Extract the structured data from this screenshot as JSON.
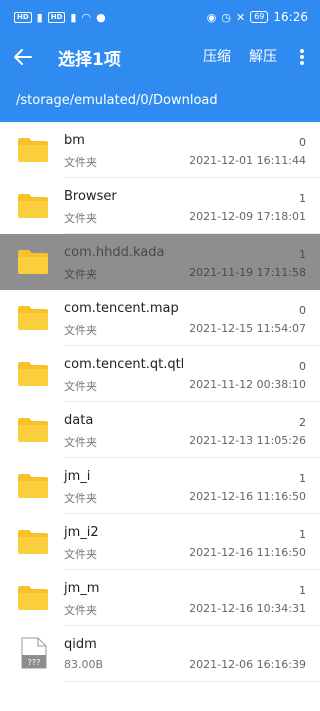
{
  "status_bar": {
    "chips": [
      "HD",
      "HD"
    ],
    "time": "16:26",
    "battery": "69"
  },
  "app_bar": {
    "title": "选择1项",
    "compress_label": "压缩",
    "extract_label": "解压"
  },
  "path": "/storage/emulated/0/Download",
  "files": [
    {
      "name": "bm",
      "type": "文件夹",
      "count": "0",
      "date": "2021-12-01 16:11:44",
      "selected": false,
      "icon": "folder-icon"
    },
    {
      "name": "Browser",
      "type": "文件夹",
      "count": "1",
      "date": "2021-12-09 17:18:01",
      "selected": false,
      "icon": "folder-icon"
    },
    {
      "name": "com.hhdd.kada",
      "type": "文件夹",
      "count": "1",
      "date": "2021-11-19 17:11:58",
      "selected": true,
      "icon": "folder-icon"
    },
    {
      "name": "com.tencent.map",
      "type": "文件夹",
      "count": "0",
      "date": "2021-12-15 11:54:07",
      "selected": false,
      "icon": "folder-icon"
    },
    {
      "name": "com.tencent.qt.qtl",
      "type": "文件夹",
      "count": "0",
      "date": "2021-11-12 00:38:10",
      "selected": false,
      "icon": "folder-icon"
    },
    {
      "name": "data",
      "type": "文件夹",
      "count": "2",
      "date": "2021-12-13 11:05:26",
      "selected": false,
      "icon": "folder-icon"
    },
    {
      "name": "jm_i",
      "type": "文件夹",
      "count": "1",
      "date": "2021-12-16 11:16:50",
      "selected": false,
      "icon": "folder-icon"
    },
    {
      "name": "jm_i2",
      "type": "文件夹",
      "count": "1",
      "date": "2021-12-16 11:16:50",
      "selected": false,
      "icon": "folder-icon"
    },
    {
      "name": "jm_m",
      "type": "文件夹",
      "count": "1",
      "date": "2021-12-16 10:34:31",
      "selected": false,
      "icon": "folder-icon"
    },
    {
      "name": "qidm",
      "type": "83.00B",
      "count": "",
      "date": "2021-12-06 16:16:39",
      "selected": false,
      "icon": "unknown-file-icon",
      "file_icon_text": "???"
    }
  ],
  "colors": {
    "accent": "#2f8bf0",
    "folder": "#f7c12b",
    "selected_row": "#8e8e8e"
  }
}
